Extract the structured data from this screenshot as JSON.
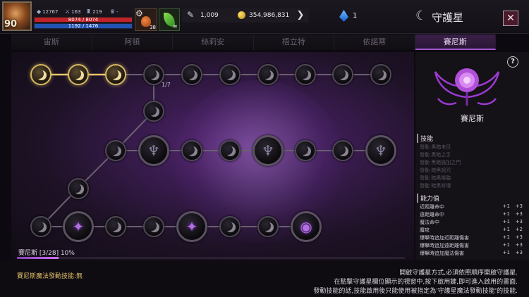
{
  "player": {
    "level": "90",
    "stats": [
      "12767",
      "163",
      "219",
      "-"
    ],
    "hp": "8074 / 8074",
    "mp": "1192 / 1476"
  },
  "quick": {
    "potion_count": "38",
    "herb_count": "∞"
  },
  "currency": {
    "crystals": "1,009",
    "gold": "354,986,831",
    "gems": "1"
  },
  "header": {
    "title_icon": "guardian-star-icon",
    "title": "守護星",
    "close": "✕"
  },
  "tabs": [
    {
      "label": "宙斯",
      "active": false
    },
    {
      "label": "阿頓",
      "active": false
    },
    {
      "label": "絲莉安",
      "active": false
    },
    {
      "label": "梧立特",
      "active": false
    },
    {
      "label": "依諾蒂",
      "active": false
    },
    {
      "label": "賽尼斯",
      "active": true
    }
  ],
  "board": {
    "node_count_label": "1/7",
    "progress_label": "賽尼斯 [3/28] 10%",
    "progress_fraction": 0.107
  },
  "panel": {
    "help": "?",
    "star_name": "賽尼斯",
    "skills_title": "技能",
    "skills": [
      "發動 黑暗末日",
      "發動 黑暗之手",
      "發動 黑暗施加之門",
      "發動 暗黑詛咒",
      "發動 暗黑降臨",
      "發動 暗黑祈禱"
    ],
    "stats_title": "能力值",
    "stats": [
      {
        "name": "近距離命中",
        "cur": "+1",
        "max": "+3"
      },
      {
        "name": "遠距離命中",
        "cur": "+1",
        "max": "+3"
      },
      {
        "name": "魔法命中",
        "cur": "+1",
        "max": "+3"
      },
      {
        "name": "魔攻",
        "cur": "+1",
        "max": "+2"
      },
      {
        "name": "爆擊時追加近距離傷害",
        "cur": "+1",
        "max": "+3"
      },
      {
        "name": "爆擊時追加遠距離傷害",
        "cur": "+1",
        "max": "+3"
      },
      {
        "name": "爆擊時追加魔法傷害",
        "cur": "+1",
        "max": "+3"
      }
    ]
  },
  "footer": {
    "skill_status": "賽尼斯魔法發動技能:無",
    "help_lines": [
      "開啟守護星方式,必須依照順序開啟守護星.",
      "在點擊守護星欄位顯示的視窗中,按下啟用鍵,即可進入啟用的畫面.",
      "發動技能的話,技能啟用後只能使用被指定為'守護星魔法發動技能'的技能."
    ]
  }
}
